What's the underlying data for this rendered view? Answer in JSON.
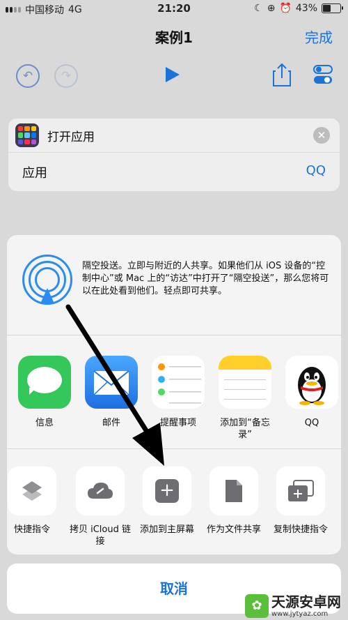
{
  "status_bar": {
    "carrier": "中国移动",
    "network": "4G",
    "time": "21:20",
    "battery": "43%"
  },
  "nav": {
    "title": "案例1",
    "done": "完成"
  },
  "action_card": {
    "title": "打开应用",
    "param_label": "应用",
    "param_value": "QQ"
  },
  "airdrop": {
    "text": "隔空投送。立即与附近的人共享。如果他们从 iOS 设备的“控制中心”或 Mac 上的“访达”中打开了“隔空投送”，那么您将可以在此处看到他们。轻点即可共享。"
  },
  "apps": [
    {
      "label": "信息"
    },
    {
      "label": "邮件"
    },
    {
      "label": "提醒事项"
    },
    {
      "label": "添加到“备忘录”"
    },
    {
      "label": "QQ"
    }
  ],
  "actions": [
    {
      "label": "快捷指令"
    },
    {
      "label": "拷贝 iCloud 链接"
    },
    {
      "label": "添加到主屏幕"
    },
    {
      "label": "作为文件共享"
    },
    {
      "label": "复制快捷指令"
    }
  ],
  "cancel": "取消",
  "watermark": {
    "name": "天源安卓网",
    "url": "www.jytyaz.com"
  },
  "colors": {
    "accent": "#1a73d9",
    "airdrop": "#2a8cf0",
    "messages": "#34c759",
    "mail": "#1e88e5"
  }
}
